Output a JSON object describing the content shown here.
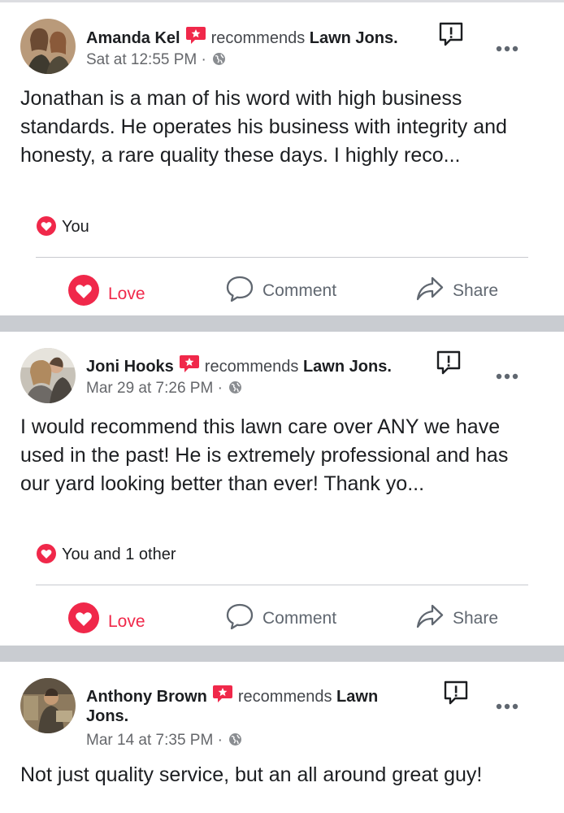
{
  "posts": [
    {
      "author": "Amanda Kel",
      "verb": "recommends",
      "page": "Lawn Jons.",
      "timestamp": "Sat at 12:55 PM",
      "separator": "·",
      "body": "Jonathan is a man of his word with high business standards.  He operates his business with integrity and honesty, a rare quality these days. I highly reco...",
      "reactions": "You",
      "actions": {
        "love": "Love",
        "comment": "Comment",
        "share": "Share"
      }
    },
    {
      "author": "Joni Hooks",
      "verb": "recommends",
      "page": "Lawn Jons.",
      "timestamp": "Mar 29 at 7:26 PM",
      "separator": "·",
      "body": "I would recommend this lawn care over ANY we have used in the past! He is extremely professional and has our yard looking better than ever! Thank yo...",
      "reactions": "You and 1 other",
      "actions": {
        "love": "Love",
        "comment": "Comment",
        "share": "Share"
      }
    },
    {
      "author": "Anthony Brown",
      "verb": "recommends",
      "page_line1": "Lawn",
      "page_line2": "Jons.",
      "timestamp": "Mar 14 at 7:35 PM",
      "separator": "·",
      "body": "Not just quality service, but an all around great guy!"
    }
  ],
  "colors": {
    "love_red": "#f0284a",
    "recommend_badge": "#f0284a",
    "text_primary": "#1c1e21",
    "text_secondary": "#65676b",
    "divider_band": "#c9ccd1"
  },
  "icons": {
    "recommend": "recommend-badge-icon",
    "globe": "globe-icon",
    "report": "report-icon",
    "more": "more-options-icon",
    "heart": "heart-icon",
    "comment": "comment-icon",
    "share": "share-icon"
  }
}
